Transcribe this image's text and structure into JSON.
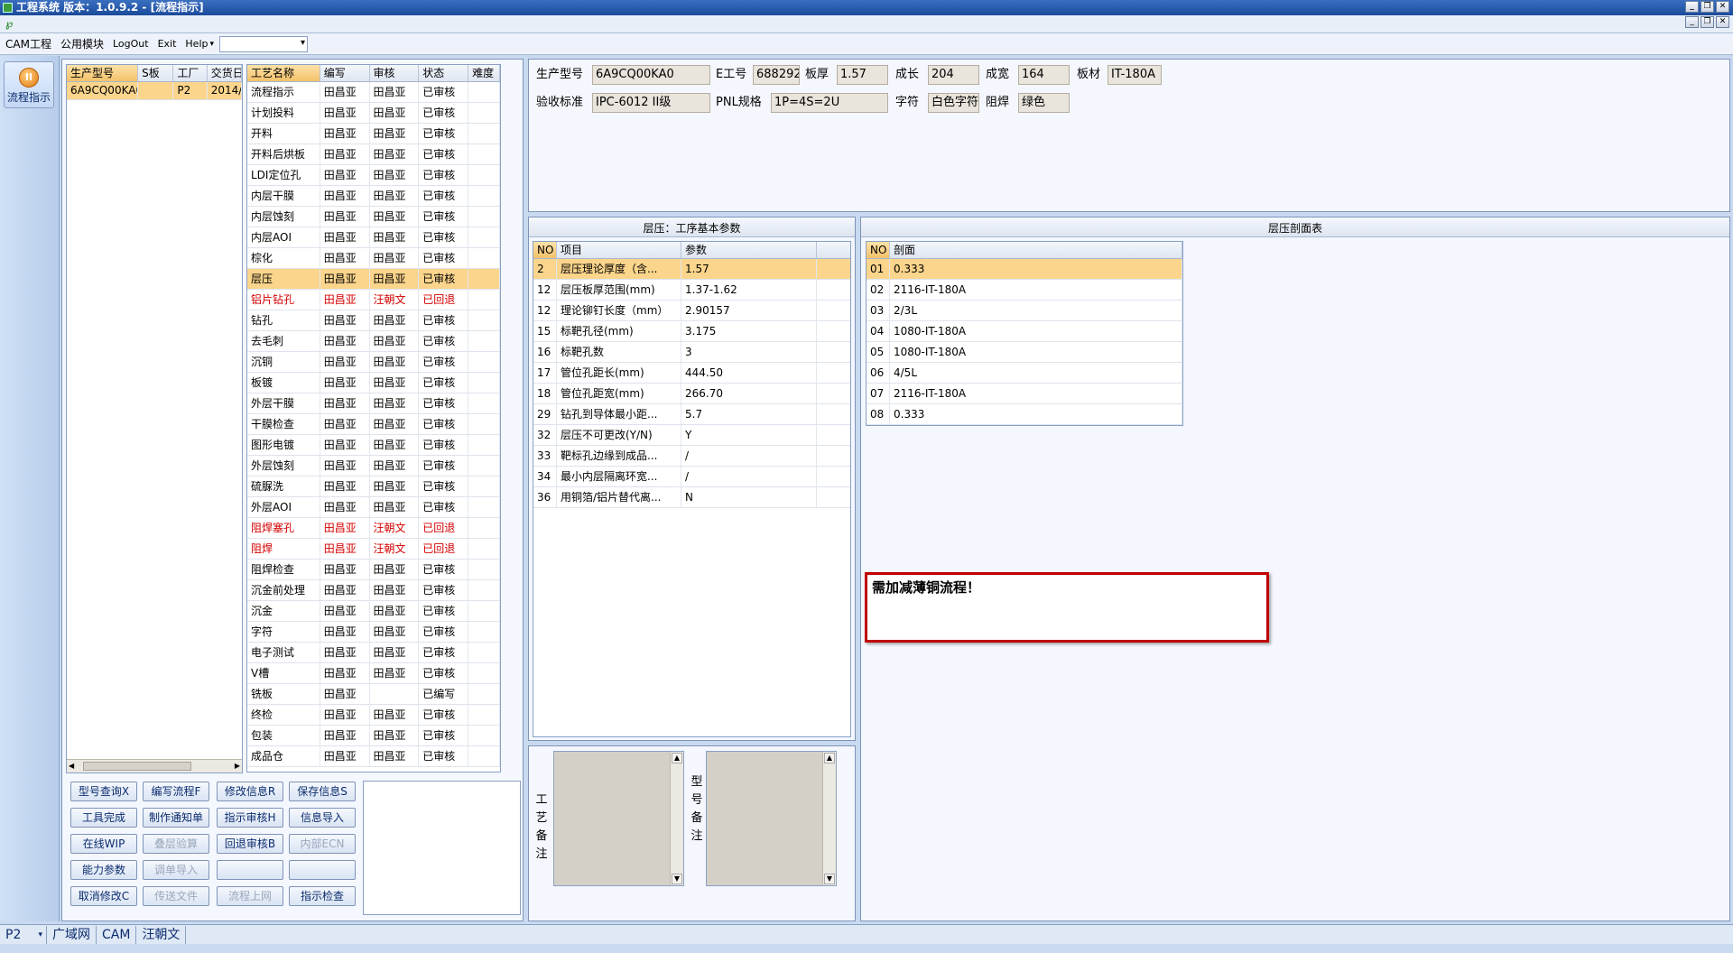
{
  "window": {
    "title": "工程系统    版本：1.0.9.2 - [流程指示]"
  },
  "menu": {
    "items": [
      "CAM工程",
      "公用模块",
      "LogOut",
      "Exit",
      "Help"
    ],
    "combo_value": ""
  },
  "nav": {
    "button_label": "流程指示"
  },
  "models": {
    "columns": [
      "生产型号",
      "S板",
      "工厂",
      "交货日"
    ],
    "rows": [
      [
        "6A9CQ00KA0",
        "",
        "P2",
        "2014/"
      ]
    ]
  },
  "process": {
    "columns": [
      "工艺名称",
      "编写",
      "审核",
      "状态",
      "难度"
    ],
    "rows": [
      {
        "cells": [
          "流程指示",
          "田昌亚",
          "田昌亚",
          "已审核",
          ""
        ]
      },
      {
        "cells": [
          "计划投料",
          "田昌亚",
          "田昌亚",
          "已审核",
          ""
        ]
      },
      {
        "cells": [
          "开料",
          "田昌亚",
          "田昌亚",
          "已审核",
          ""
        ]
      },
      {
        "cells": [
          "开料后烘板",
          "田昌亚",
          "田昌亚",
          "已审核",
          ""
        ]
      },
      {
        "cells": [
          "LDI定位孔",
          "田昌亚",
          "田昌亚",
          "已审核",
          ""
        ]
      },
      {
        "cells": [
          "内层干膜",
          "田昌亚",
          "田昌亚",
          "已审核",
          ""
        ]
      },
      {
        "cells": [
          "内层蚀刻",
          "田昌亚",
          "田昌亚",
          "已审核",
          ""
        ]
      },
      {
        "cells": [
          "内层AOI",
          "田昌亚",
          "田昌亚",
          "已审核",
          ""
        ]
      },
      {
        "cells": [
          "棕化",
          "田昌亚",
          "田昌亚",
          "已审核",
          ""
        ]
      },
      {
        "cells": [
          "层压",
          "田昌亚",
          "田昌亚",
          "已审核",
          ""
        ],
        "selected": true
      },
      {
        "cells": [
          "铝片钻孔",
          "田昌亚",
          "汪朝文",
          "已回退",
          ""
        ],
        "red": true
      },
      {
        "cells": [
          "钻孔",
          "田昌亚",
          "田昌亚",
          "已审核",
          ""
        ]
      },
      {
        "cells": [
          "去毛刺",
          "田昌亚",
          "田昌亚",
          "已审核",
          ""
        ]
      },
      {
        "cells": [
          "沉铜",
          "田昌亚",
          "田昌亚",
          "已审核",
          ""
        ]
      },
      {
        "cells": [
          "板镀",
          "田昌亚",
          "田昌亚",
          "已审核",
          ""
        ]
      },
      {
        "cells": [
          "外层干膜",
          "田昌亚",
          "田昌亚",
          "已审核",
          ""
        ]
      },
      {
        "cells": [
          "干膜检查",
          "田昌亚",
          "田昌亚",
          "已审核",
          ""
        ]
      },
      {
        "cells": [
          "图形电镀",
          "田昌亚",
          "田昌亚",
          "已审核",
          ""
        ]
      },
      {
        "cells": [
          "外层蚀刻",
          "田昌亚",
          "田昌亚",
          "已审核",
          ""
        ]
      },
      {
        "cells": [
          "硫脲洗",
          "田昌亚",
          "田昌亚",
          "已审核",
          ""
        ]
      },
      {
        "cells": [
          "外层AOI",
          "田昌亚",
          "田昌亚",
          "已审核",
          ""
        ]
      },
      {
        "cells": [
          "阻焊塞孔",
          "田昌亚",
          "汪朝文",
          "已回退",
          ""
        ],
        "red": true
      },
      {
        "cells": [
          "阻焊",
          "田昌亚",
          "汪朝文",
          "已回退",
          ""
        ],
        "red": true
      },
      {
        "cells": [
          "阻焊检查",
          "田昌亚",
          "田昌亚",
          "已审核",
          ""
        ]
      },
      {
        "cells": [
          "沉金前处理",
          "田昌亚",
          "田昌亚",
          "已审核",
          ""
        ]
      },
      {
        "cells": [
          "沉金",
          "田昌亚",
          "田昌亚",
          "已审核",
          ""
        ]
      },
      {
        "cells": [
          "字符",
          "田昌亚",
          "田昌亚",
          "已审核",
          ""
        ]
      },
      {
        "cells": [
          "电子测试",
          "田昌亚",
          "田昌亚",
          "已审核",
          ""
        ]
      },
      {
        "cells": [
          "V槽",
          "田昌亚",
          "田昌亚",
          "已审核",
          ""
        ]
      },
      {
        "cells": [
          "铣板",
          "田昌亚",
          "",
          "已编写",
          ""
        ]
      },
      {
        "cells": [
          "终检",
          "田昌亚",
          "田昌亚",
          "已审核",
          ""
        ]
      },
      {
        "cells": [
          "包装",
          "田昌亚",
          "田昌亚",
          "已审核",
          ""
        ]
      },
      {
        "cells": [
          "成品仓",
          "田昌亚",
          "田昌亚",
          "已审核",
          ""
        ]
      }
    ]
  },
  "buttons": [
    {
      "label": "型号查询X",
      "enabled": true
    },
    {
      "label": "编写流程F",
      "enabled": true
    },
    {
      "label": "修改信息R",
      "enabled": true
    },
    {
      "label": "保存信息S",
      "enabled": true
    },
    {
      "label": "工具完成",
      "enabled": true
    },
    {
      "label": "制作通知单",
      "enabled": true
    },
    {
      "label": "指示审核H",
      "enabled": true
    },
    {
      "label": "信息导入",
      "enabled": true
    },
    {
      "label": "在线WIP",
      "enabled": true
    },
    {
      "label": "叠层验算",
      "enabled": false
    },
    {
      "label": "回退审核B",
      "enabled": true
    },
    {
      "label": "内部ECN",
      "enabled": false
    },
    {
      "label": "能力参数",
      "enabled": true
    },
    {
      "label": "调单导入",
      "enabled": false
    },
    {
      "label": "",
      "enabled": true
    },
    {
      "label": "",
      "enabled": true
    },
    {
      "label": "取消修改C",
      "enabled": true
    },
    {
      "label": "传送文件",
      "enabled": false
    },
    {
      "label": "流程上网",
      "enabled": false
    },
    {
      "label": "指示检查",
      "enabled": true
    }
  ],
  "info": {
    "model_label": "生产型号",
    "model": "6A9CQ00KA0",
    "e_label": "E工号",
    "e_no": "688292",
    "thick_label": "板厚",
    "thick": "1.57",
    "len_label": "成长",
    "len": "204",
    "wid_label": "成宽",
    "wid": "164",
    "mat_label": "板材",
    "mat": "IT-180A",
    "std_label": "验收标准",
    "std": "IPC-6012 II级",
    "pnl_label": "PNL规格",
    "pnl": "1P=4S=2U",
    "char_label": "字符",
    "char": "白色字符",
    "mask_label": "阻焊",
    "mask": "绿色"
  },
  "params": {
    "title": "层压：工序基本参数",
    "columns": [
      "NO",
      "项目",
      "参数"
    ],
    "rows": [
      [
        "2",
        "层压理论厚度（含...",
        "1.57"
      ],
      [
        "12",
        "层压板厚范围(mm)",
        "1.37-1.62"
      ],
      [
        "12",
        "理论铆钉长度（mm）",
        "2.90157"
      ],
      [
        "15",
        "标靶孔径(mm)",
        "3.175"
      ],
      [
        "16",
        "标靶孔数",
        "3"
      ],
      [
        "17",
        "管位孔距长(mm)",
        "444.50"
      ],
      [
        "18",
        "管位孔距宽(mm)",
        "266.70"
      ],
      [
        "29",
        "钻孔到导体最小距...",
        "5.7"
      ],
      [
        "32",
        "层压不可更改(Y/N)",
        "Y"
      ],
      [
        "33",
        "靶标孔边缘到成品...",
        "/"
      ],
      [
        "34",
        "最小内层隔离环宽...",
        "/"
      ],
      [
        "36",
        "用铜箔/铝片替代离...",
        "N"
      ]
    ]
  },
  "stackup": {
    "title": "层压剖面表",
    "columns": [
      "NO",
      "剖面"
    ],
    "rows": [
      [
        "01",
        "0.333"
      ],
      [
        "02",
        "2116-IT-180A"
      ],
      [
        "03",
        "2/3L"
      ],
      [
        "04",
        "1080-IT-180A"
      ],
      [
        "05",
        "1080-IT-180A"
      ],
      [
        "06",
        "4/5L"
      ],
      [
        "07",
        "2116-IT-180A"
      ],
      [
        "08",
        "0.333"
      ]
    ]
  },
  "note": {
    "text": "需加减薄铜流程！"
  },
  "remarks": {
    "process_label": "工艺备注",
    "model_label": "型号备注"
  },
  "status": {
    "factory": "P2",
    "cells": [
      "广域网",
      "CAM",
      "汪朝文"
    ]
  },
  "colors": {
    "highlight": "#fbd58b",
    "rollback": "#d40000",
    "note_border": "#c00000"
  }
}
